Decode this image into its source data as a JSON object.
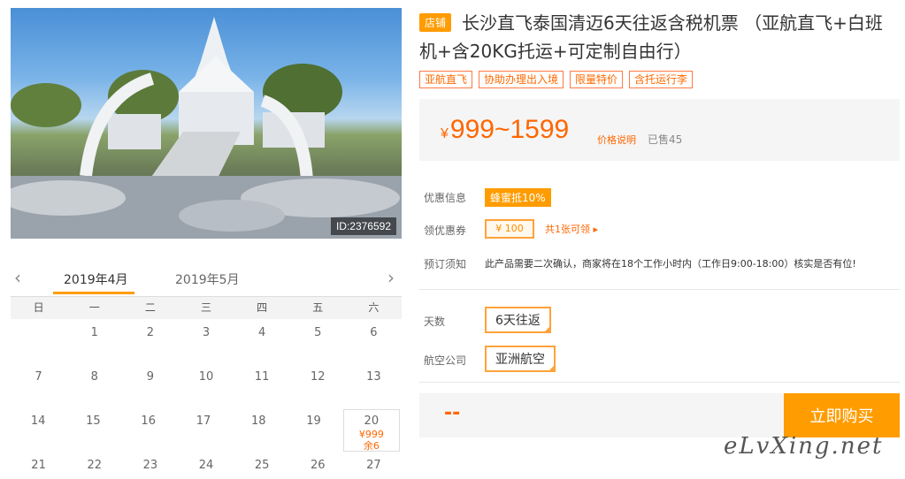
{
  "photo": {
    "id_label": "ID:2376592"
  },
  "calendar": {
    "prev_icon": "chevron-left-icon",
    "next_icon": "chevron-right-icon",
    "months": [
      "2019年4月",
      "2019年5月"
    ],
    "weekdays": [
      "日",
      "一",
      "二",
      "三",
      "四",
      "五",
      "六"
    ],
    "rows": [
      [
        "",
        "1",
        "2",
        "3",
        "4",
        "5",
        "6"
      ],
      [
        "7",
        "8",
        "9",
        "10",
        "11",
        "12",
        "13"
      ],
      [
        "14",
        "15",
        "16",
        "17",
        "18",
        "19",
        "20"
      ],
      [
        "21",
        "22",
        "23",
        "24",
        "25",
        "26",
        "27"
      ]
    ],
    "special_day": {
      "day": "20",
      "price": "¥999",
      "stock": "余6"
    }
  },
  "product": {
    "store_badge": "店铺",
    "title": "长沙直飞泰国清迈6天往返含税机票 （亚航直飞+白班机+含20KG托运+可定制自由行）",
    "tags": [
      "亚航直飞",
      "协助办理出入境",
      "限量特价",
      "含托运行李"
    ],
    "price_yen": "¥",
    "price_range": "999~1599",
    "price_note": "价格说明",
    "sold": "已售45"
  },
  "info": {
    "discount_label": "优惠信息",
    "discount_value": "蜂蜜抵10%",
    "coupon_label": "领优惠券",
    "coupon_value": "¥ 100",
    "coupon_count": "共1张可领 ▸",
    "notice_label": "预订须知",
    "notice_text": "此产品需要二次确认，商家将在18个工作小时内（工作日9:00-18:00）核实是否有位!",
    "days_label": "天数",
    "days_value": "6天往返",
    "airline_label": "航空公司",
    "airline_value": "亚洲航空"
  },
  "buy": {
    "price": "--",
    "button": "立即购买"
  },
  "watermark": "eLvXing.net",
  "colors": {
    "accent": "#ff9c00",
    "price": "#ff6600"
  }
}
